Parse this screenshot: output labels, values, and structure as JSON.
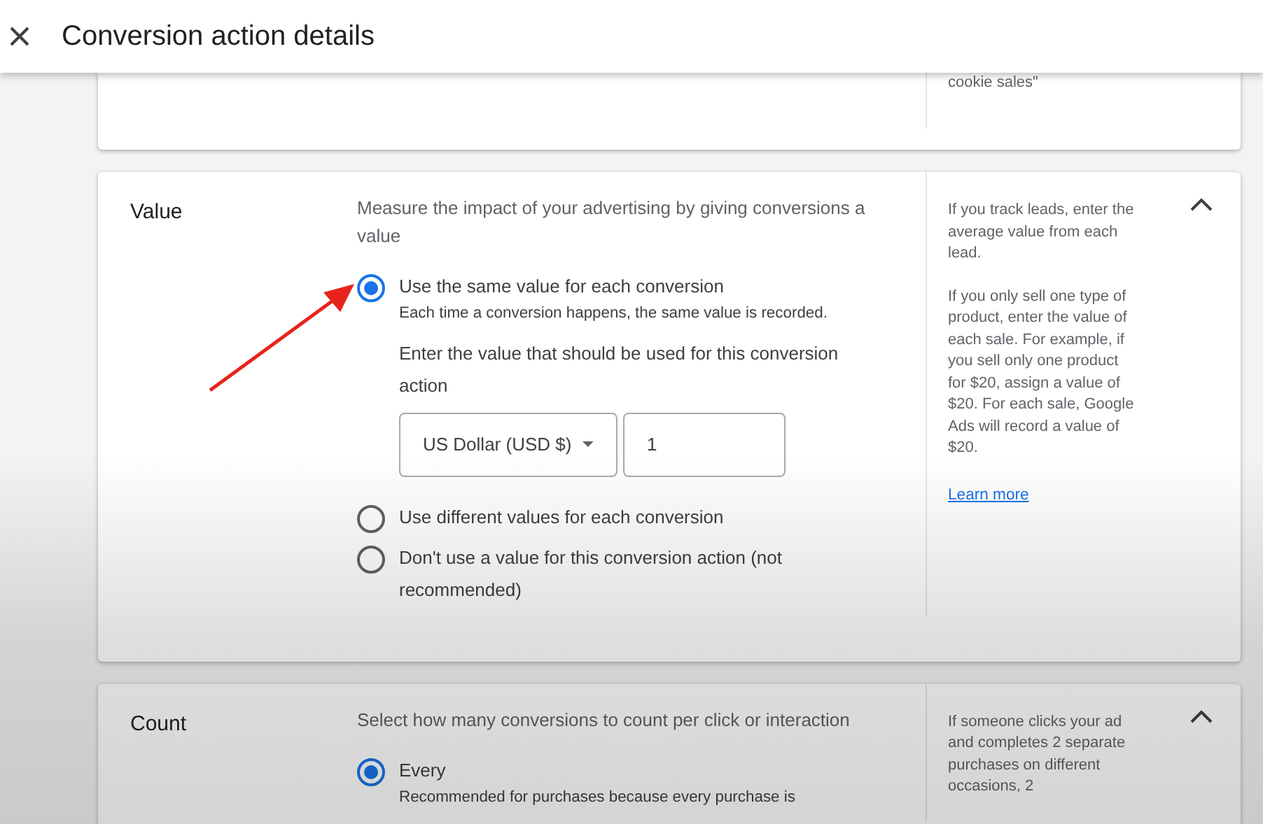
{
  "header": {
    "title": "Conversion action details"
  },
  "sections": [
    {
      "kind": "partial",
      "help": [
        "cookie sales\""
      ]
    },
    {
      "kind": "full",
      "title": "Value",
      "expanded": true,
      "description": "Measure the impact of your advertising by giving conversions a value",
      "options": [
        {
          "label": "Use the same value for each conversion",
          "sublabel": "Each time a conversion happens, the same value is recorded.",
          "selected": true,
          "prompt": "Enter the value that should be used for this conversion action",
          "currency": "US Dollar (USD $)",
          "amount": "1"
        },
        {
          "label": "Use different values for each conversion",
          "selected": false
        },
        {
          "label": "Don't use a value for this conversion action (not recommended)",
          "selected": false
        }
      ],
      "help": [
        "If you track leads, enter the average value from each lead.",
        "If you only sell one type of product, enter the value of each sale. For example, if you sell only one product for $20, assign a value of $20. For each sale, Google Ads will record a value of $20."
      ],
      "help_link": "Learn more"
    },
    {
      "kind": "full",
      "title": "Count",
      "expanded": true,
      "description": "Select how many conversions to count per click or interaction",
      "options": [
        {
          "label": "Every",
          "sublabel": "Recommended for purchases because every purchase is",
          "selected": true
        }
      ],
      "help": [
        "If someone clicks your ad and completes 2 separate purchases on different occasions, 2"
      ]
    }
  ]
}
